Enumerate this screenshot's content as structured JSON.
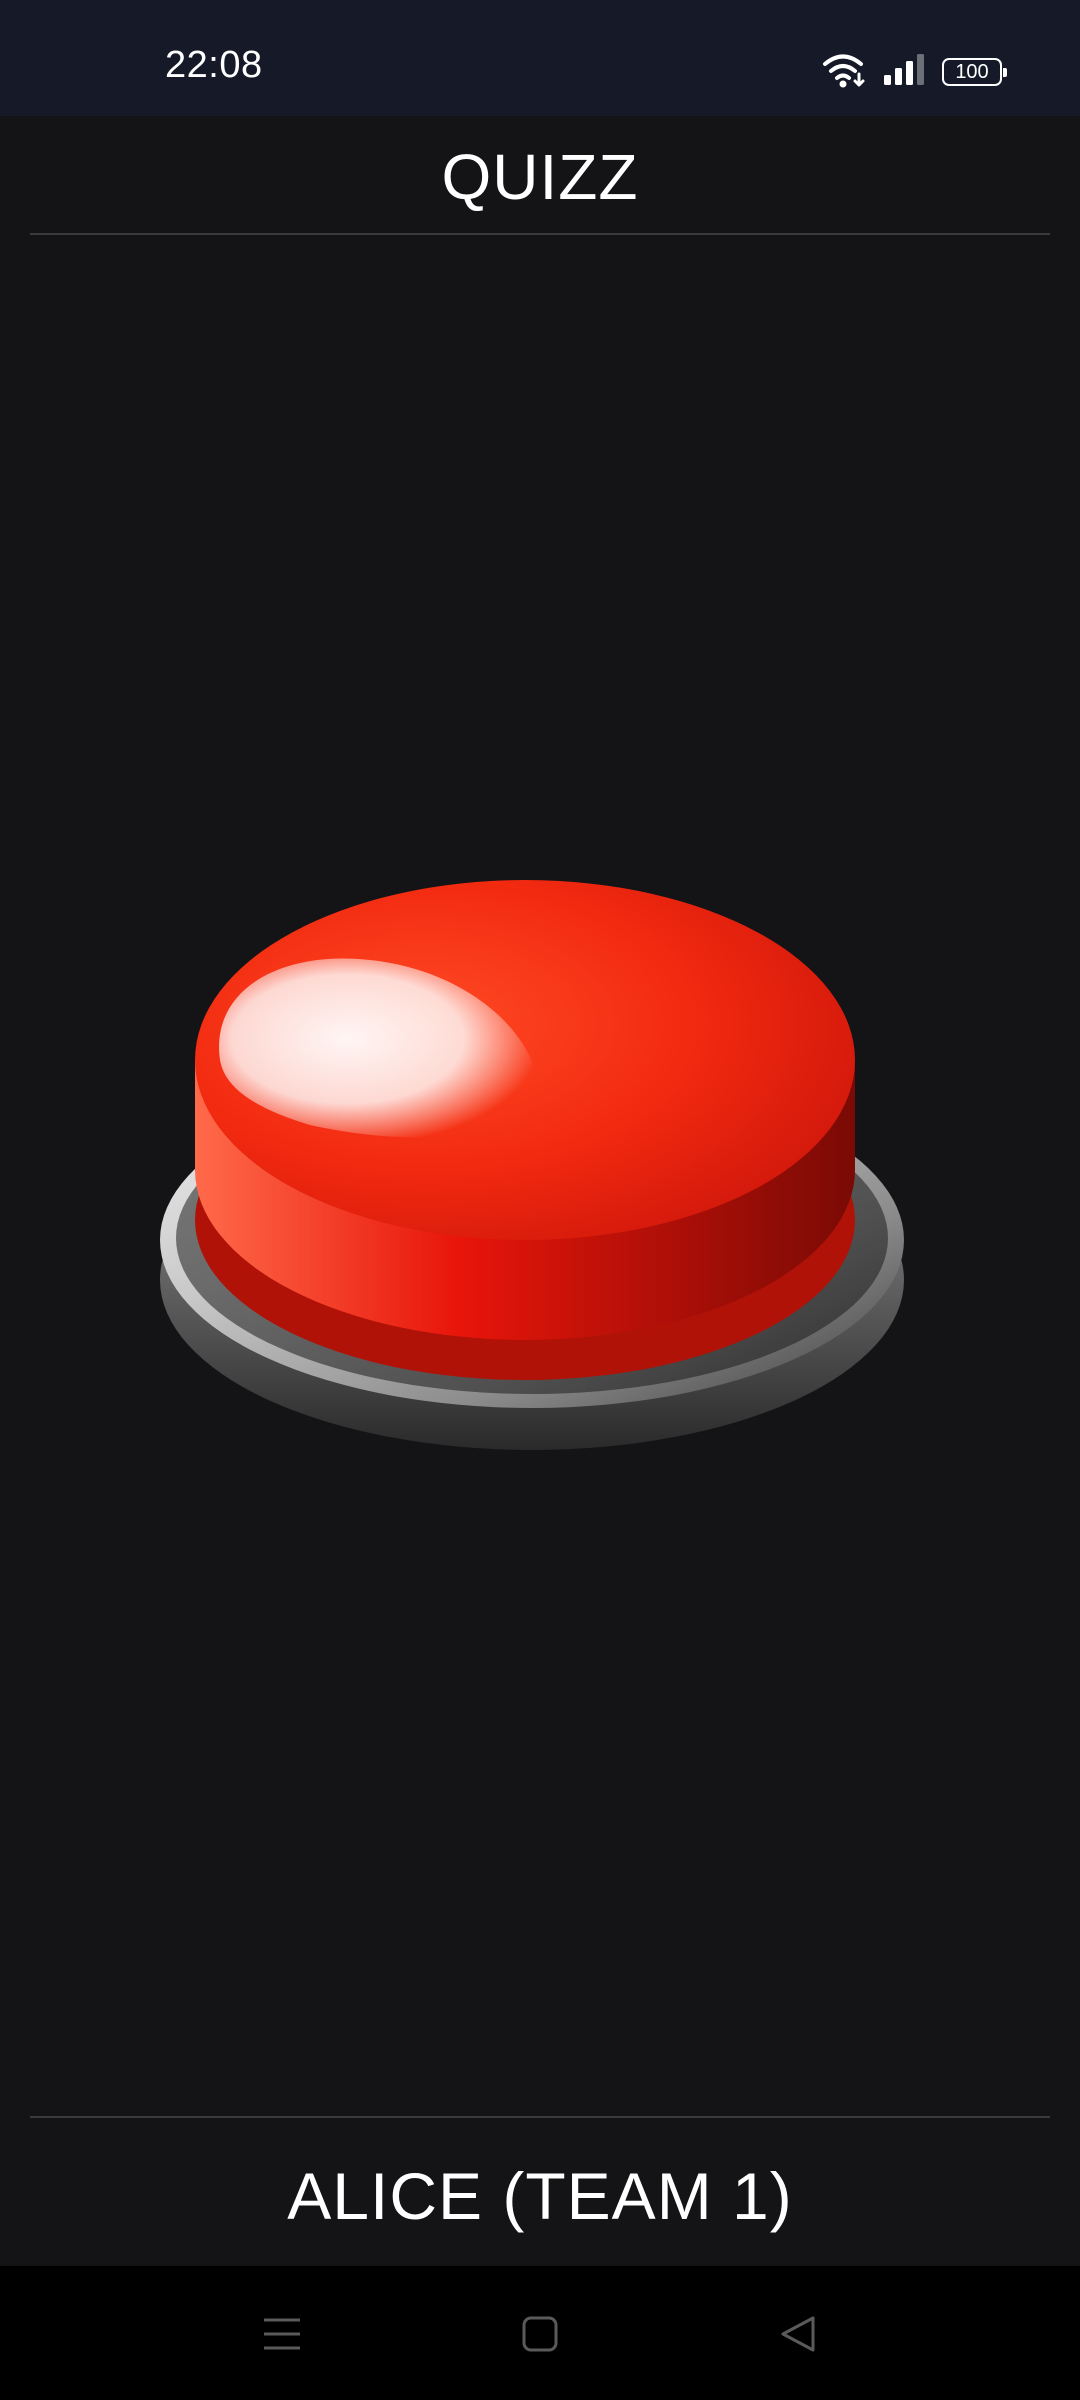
{
  "status_bar": {
    "time": "22:08",
    "battery": "100",
    "icons": [
      "wifi-icon",
      "signal-icon",
      "battery-icon"
    ]
  },
  "header": {
    "title": "QUIZZ"
  },
  "main": {
    "buzzer_icon": "red-buzzer-button"
  },
  "footer": {
    "player": "ALICE (TEAM 1)"
  },
  "nav_bar": {
    "icons": [
      "menu-icon",
      "home-icon",
      "back-icon"
    ]
  },
  "colors": {
    "background": "#141316",
    "status_bar": "#161a28",
    "buzzer_red": "#f01e0a",
    "text": "#ffffff"
  }
}
